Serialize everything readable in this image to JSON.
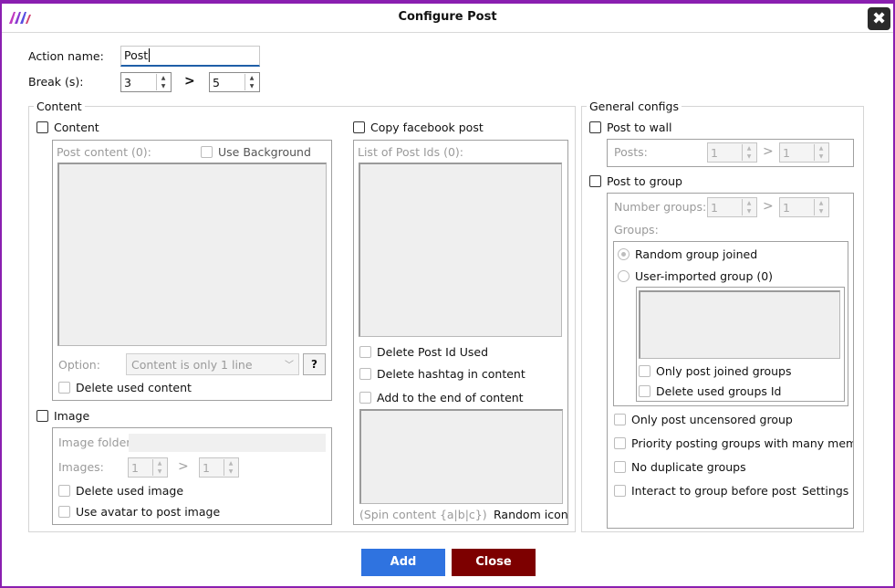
{
  "window": {
    "title": "Configure Post",
    "close_glyph": "✖",
    "logo": "app-logo-icon",
    "accent": "#8a1fb0"
  },
  "form": {
    "action_name_label": "Action name:",
    "action_name_value": "Post",
    "break_label": "Break (s):",
    "break_min": "3",
    "break_max": "5",
    "range_sep": ">"
  },
  "content_group": {
    "title": "Content",
    "content_check": "Content",
    "post_content_label": "Post content (0):",
    "use_background": "Use Background",
    "option_label": "Option:",
    "option_value": "Content is only 1 line",
    "help": "?",
    "delete_used_content": "Delete used content",
    "copy_post_check": "Copy facebook post",
    "list_post_ids_label": "List of Post Ids (0):",
    "delete_post_id_used": "Delete Post Id Used",
    "delete_hashtag": "Delete hashtag in content",
    "add_to_end": "Add to the end of content",
    "spin_content": "(Spin content {a|b|c})",
    "random_icon": "Random icon",
    "image_check": "Image",
    "image_folder_label": "Image folder:",
    "images_label": "Images:",
    "images_min": "1",
    "images_max": "1",
    "delete_used_image": "Delete used image",
    "use_avatar": "Use avatar to post image"
  },
  "general_group": {
    "title": "General configs",
    "post_to_wall": "Post to wall",
    "posts_label": "Posts:",
    "posts_min": "1",
    "posts_max": "1",
    "post_to_group": "Post to group",
    "number_groups_label": "Number groups:",
    "groups_min": "1",
    "groups_max": "1",
    "groups_label": "Groups:",
    "random_group_joined": "Random group joined",
    "user_imported_group": "User-imported group (0)",
    "only_post_joined": "Only post joined groups",
    "delete_used_groups": "Delete used groups Id",
    "only_uncensored": "Only post uncensored group",
    "priority_posting": "Priority posting groups with many member",
    "no_duplicate": "No duplicate groups",
    "interact_before": "Interact to group before post",
    "settings": "Settings"
  },
  "footer": {
    "add_label": "Add",
    "close_label": "Close",
    "add_color": "#2f73e0",
    "close_color": "#7d0000"
  }
}
